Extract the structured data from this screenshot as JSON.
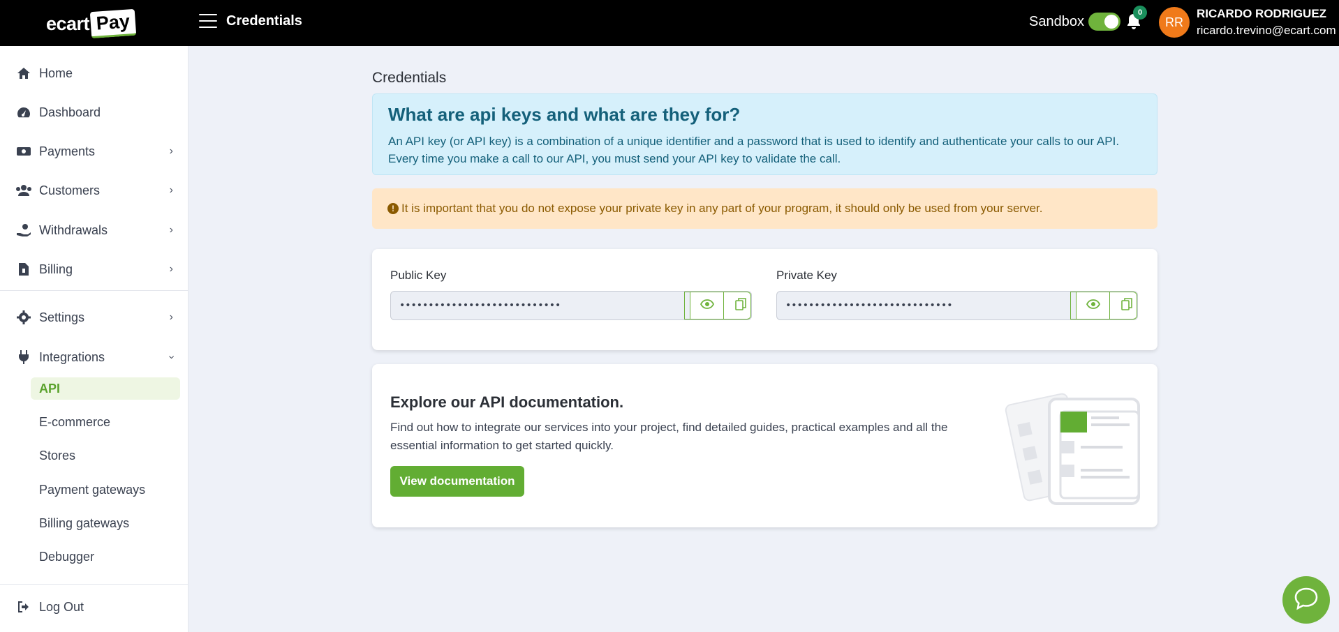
{
  "header": {
    "logo_text": "ecart",
    "logo_box": "Pay",
    "page_title": "Credentials",
    "sandbox_label": "Sandbox",
    "notifications_count": "0",
    "user": {
      "initials": "RR",
      "name": "RICARDO RODRIGUEZ",
      "email": "ricardo.trevino@ecart.com"
    },
    "accent_color": "#6fb33c"
  },
  "sidebar": {
    "items": [
      {
        "label": "Home",
        "icon": "home-icon"
      },
      {
        "label": "Dashboard",
        "icon": "gauge-icon"
      },
      {
        "label": "Payments",
        "icon": "money-icon"
      },
      {
        "label": "Customers",
        "icon": "users-icon"
      },
      {
        "label": "Withdrawals",
        "icon": "hand-coin-icon"
      },
      {
        "label": "Billing",
        "icon": "invoice-icon"
      },
      {
        "label": "Settings",
        "icon": "gear-icon"
      },
      {
        "label": "Integrations",
        "icon": "plug-icon"
      }
    ],
    "integrations_sub": [
      "API",
      "E-commerce",
      "Stores",
      "Payment gateways",
      "Billing gateways",
      "Debugger"
    ],
    "logout_label": "Log Out"
  },
  "main": {
    "title": "Credentials",
    "info": {
      "title": "What are api keys and what are they for?",
      "text": "An API key (or API key) is a combination of a unique identifier and a password that is used to identify and authenticate your calls to our API. Every time you make a call to our API, you must send your API key to validate the call."
    },
    "warning": "It is important that you do not expose your private key in any part of your program, it should only be used from your server.",
    "keys": {
      "public_label": "Public Key",
      "public_value": "••••••••••••••••••••••••••••",
      "private_label": "Private Key",
      "private_value": "•••••••••••••••••••••••••••••"
    },
    "docs": {
      "title": "Explore our API documentation.",
      "text": "Find out how to integrate our services into your project, find detailed guides, practical examples and all the essential information to get started quickly.",
      "button": "View documentation"
    }
  }
}
